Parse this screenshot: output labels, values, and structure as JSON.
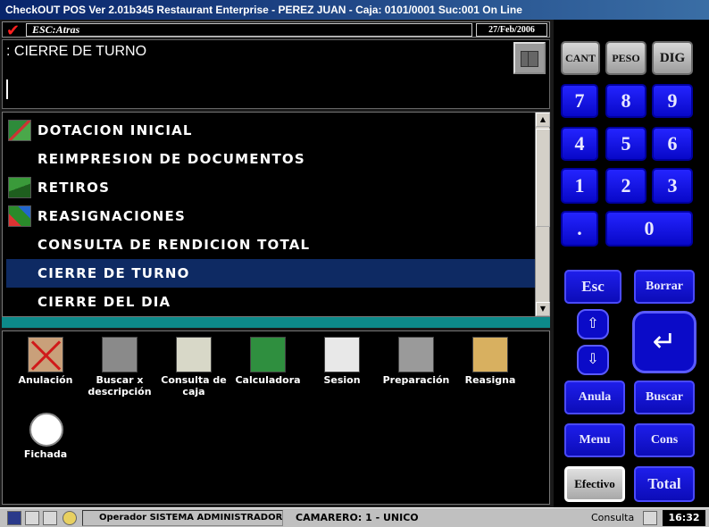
{
  "window": {
    "title": "CheckOUT POS Ver 2.01b345 Restaurant Enterprise - PEREZ JUAN - Caja: 0101/0001 Suc:001  On Line"
  },
  "cmdbar": {
    "esc_label": "ESC:Atras",
    "date": "27/Feb/2006",
    "check_icon": "✔"
  },
  "prompt": {
    "text": ": CIERRE DE TURNO"
  },
  "menu": {
    "selected_index": 5,
    "items": [
      {
        "label": "DOTACION INICIAL",
        "icon": "money-icon"
      },
      {
        "label": "REIMPRESION DE DOCUMENTOS",
        "icon": ""
      },
      {
        "label": "RETIROS",
        "icon": "retiros-icon"
      },
      {
        "label": "REASIGNACIONES",
        "icon": "reasignaciones-icon"
      },
      {
        "label": "CONSULTA DE RENDICION TOTAL",
        "icon": ""
      },
      {
        "label": "CIERRE DE TURNO",
        "icon": ""
      },
      {
        "label": "CIERRE DEL DIA",
        "icon": ""
      }
    ]
  },
  "toolbar": {
    "items": [
      {
        "label": "Anulación",
        "icon": "anulacion-icon"
      },
      {
        "label": "Buscar x descripción",
        "icon": "binoculars-icon"
      },
      {
        "label": "Consulta de caja",
        "icon": "cash-register-icon"
      },
      {
        "label": "Calculadora",
        "icon": "calculator-icon"
      },
      {
        "label": "Sesion",
        "icon": "session-icon"
      },
      {
        "label": "Preparación",
        "icon": "printer-icon"
      },
      {
        "label": "Reasigna",
        "icon": "folders-icon"
      },
      {
        "label": "Fichada",
        "icon": "clock-icon"
      }
    ]
  },
  "keypad": {
    "mode_keys": [
      "CANT",
      "PESO",
      "DIG"
    ],
    "digits": [
      "7",
      "8",
      "9",
      "4",
      "5",
      "6",
      "1",
      "2",
      "3",
      ".",
      "0"
    ],
    "esc": "Esc",
    "borrar": "Borrar",
    "up": "⇧",
    "down": "⇩",
    "enter": "↵",
    "anula": "Anula",
    "buscar": "Buscar",
    "menu": "Menu",
    "cons": "Cons",
    "efectivo": "Efectivo",
    "total": "Total"
  },
  "status": {
    "operador": "Operador  SISTEMA ADMINISTRADOR",
    "camarero": "CAMARERO: 1 -  UNICO",
    "consulta": "Consulta",
    "time": "16:32"
  }
}
